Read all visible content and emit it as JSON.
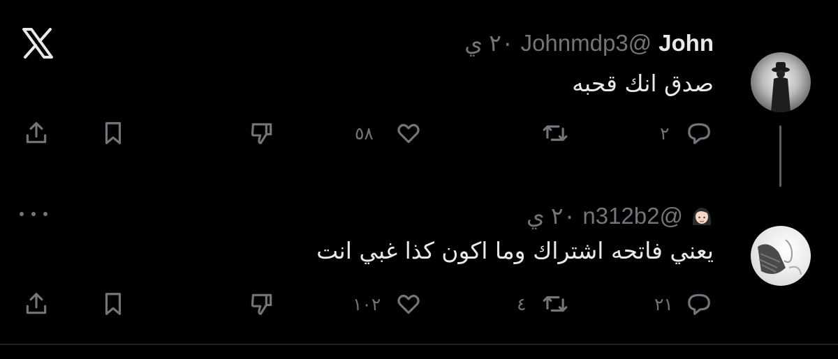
{
  "app": {
    "logo_icon": "x-logo-icon"
  },
  "colors": {
    "background": "#000000",
    "primary_text": "#e7e9ea",
    "secondary_text": "#71767b"
  },
  "tweets": [
    {
      "avatar_icon": "avatar-figure-in-fog",
      "name": "John",
      "handle": "Johnmdp3@",
      "time": "٢٠ ي",
      "text": "صدق انك قحبه",
      "actions": {
        "reply_count": "٢",
        "retweet_count": "",
        "like_count": "٥٨"
      }
    },
    {
      "avatar_icon": "avatar-photo",
      "name_emoji_icon": "woman-emoji-icon",
      "handle": "n312b2@",
      "time": "٢٠ ي",
      "text": "يعني فاتحه اشتراك وما اكون كذا غبي انت",
      "actions": {
        "reply_count": "٢١",
        "retweet_count": "٤",
        "like_count": "١٠٢"
      }
    }
  ]
}
